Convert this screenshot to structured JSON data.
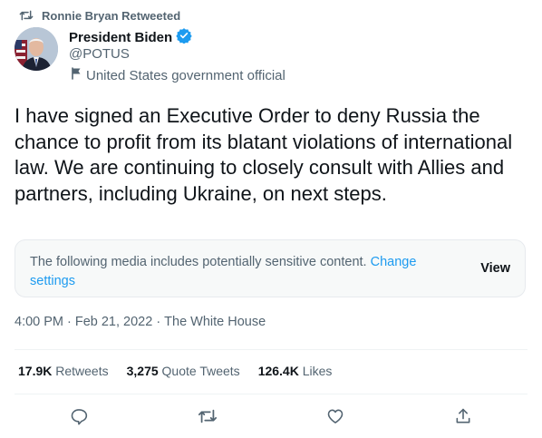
{
  "retweet_banner": {
    "text": "Ronnie Bryan Retweeted"
  },
  "author": {
    "name": "President Biden",
    "handle": "@POTUS",
    "affiliation": "United States government official",
    "verified": true
  },
  "tweet": {
    "text": "I have signed an Executive Order to deny Russia the chance to profit from its blatant violations of international law. We are continuing to closely consult with Allies and partners, including Ukraine, on next steps."
  },
  "sensitive_media": {
    "message": "The following media includes potentially sensitive content.",
    "link_label": "Change settings",
    "view_label": "View"
  },
  "meta": {
    "time": "4:00 PM",
    "separator": "·",
    "date": "Feb 21, 2022",
    "source": "The White House"
  },
  "stats": {
    "retweets_count": "17.9K",
    "retweets_label": "Retweets",
    "quotes_count": "3,275",
    "quotes_label": "Quote Tweets",
    "likes_count": "126.4K",
    "likes_label": "Likes"
  },
  "colors": {
    "accent": "#1d9bf0",
    "secondary_text": "#536471",
    "primary_text": "#0f1419"
  },
  "icons": [
    "retweet-icon",
    "verified-badge-icon",
    "flag-icon",
    "reply-icon",
    "retweet-icon",
    "like-icon",
    "share-icon"
  ]
}
